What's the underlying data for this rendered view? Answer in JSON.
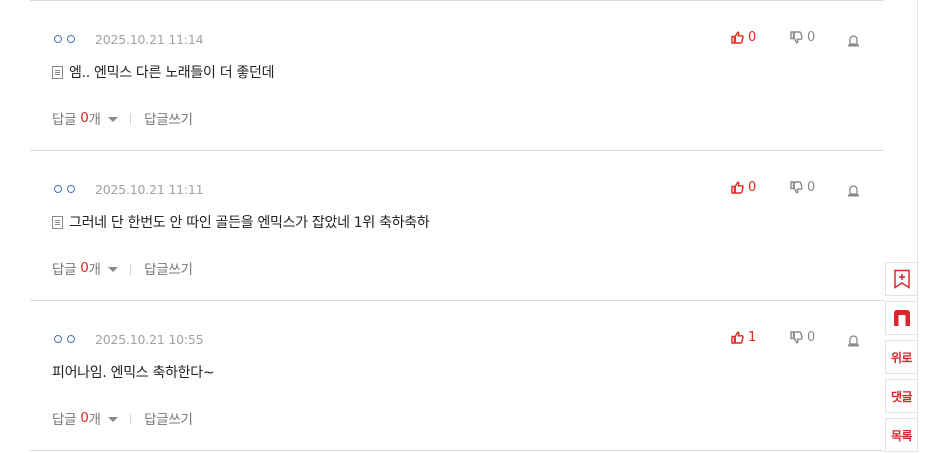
{
  "comments": [
    {
      "date": "2025.10.21 11:14",
      "text": "엠.. 엔믹스 다른 노래들이 더 좋던데",
      "has_icon": true,
      "reply_prefix": "답글",
      "reply_count": "0",
      "reply_suffix": "개",
      "write_reply": "답글쓰기",
      "up": "0",
      "down": "0"
    },
    {
      "date": "2025.10.21 11:11",
      "text": "그러네 단 한번도 안 따인 골든을 엔믹스가 잡았네 1위 축하축하",
      "has_icon": true,
      "reply_prefix": "답글",
      "reply_count": "0",
      "reply_suffix": "개",
      "write_reply": "답글쓰기",
      "up": "0",
      "down": "0"
    },
    {
      "date": "2025.10.21 10:55",
      "text": "피어나임. 엔믹스 축하한다~",
      "has_icon": false,
      "reply_prefix": "답글",
      "reply_count": "0",
      "reply_suffix": "개",
      "write_reply": "답글쓰기",
      "up": "1",
      "down": "0"
    }
  ],
  "side_buttons": {
    "bookmark_icon": "bookmark-plus-icon",
    "logo_icon": "n-logo",
    "top_label": "위로",
    "comment_label": "댓글",
    "list_label": "목록"
  },
  "colors": {
    "accent": "#e0281f",
    "nick_dots": "#4a73b8",
    "muted": "#a2a2a2"
  }
}
